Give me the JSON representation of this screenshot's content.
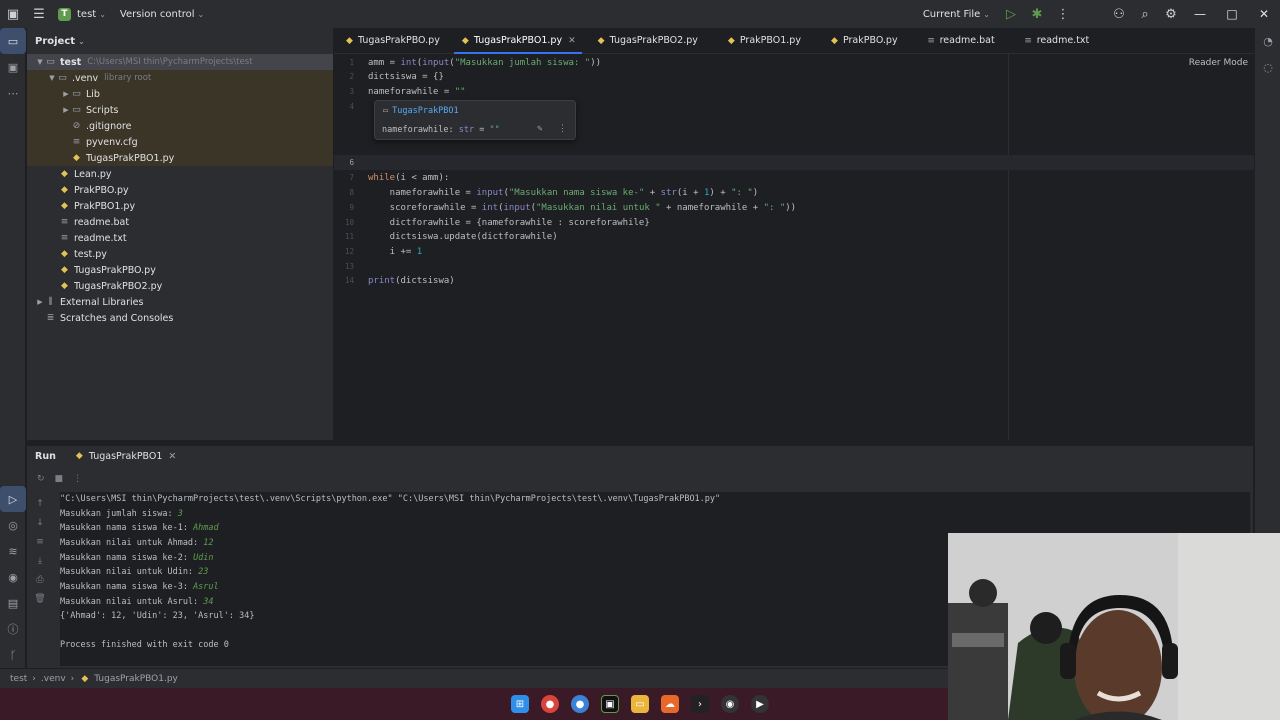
{
  "titlebar": {
    "project_badge": "T",
    "project_name": "test",
    "vcs": "Version control",
    "run_config": "Current File"
  },
  "project_panel": {
    "title": "Project",
    "tree": [
      {
        "label": "test",
        "extra": "C:\\Users\\MSI thin\\PycharmProjects\\test",
        "icon": "folder-icon"
      },
      {
        "label": ".venv",
        "extra": "library root",
        "icon": "folder-icon"
      },
      {
        "label": "Lib",
        "extra": "",
        "icon": "folder-icon"
      },
      {
        "label": "Scripts",
        "extra": "",
        "icon": "folder-icon"
      },
      {
        "label": ".gitignore",
        "extra": "",
        "icon": "ignore-file-icon"
      },
      {
        "label": "pyvenv.cfg",
        "extra": "",
        "icon": "config-file-icon"
      },
      {
        "label": "TugasPrakPBO1.py",
        "extra": "",
        "icon": "python-file-icon"
      },
      {
        "label": "Lean.py",
        "extra": "",
        "icon": "python-file-icon"
      },
      {
        "label": "PrakPBO.py",
        "extra": "",
        "icon": "python-file-icon"
      },
      {
        "label": "PrakPBO1.py",
        "extra": "",
        "icon": "python-file-icon"
      },
      {
        "label": "readme.bat",
        "extra": "",
        "icon": "text-file-icon"
      },
      {
        "label": "readme.txt",
        "extra": "",
        "icon": "text-file-icon"
      },
      {
        "label": "test.py",
        "extra": "",
        "icon": "python-file-icon"
      },
      {
        "label": "TugasPrakPBO.py",
        "extra": "",
        "icon": "python-file-icon"
      },
      {
        "label": "TugasPrakPBO2.py",
        "extra": "",
        "icon": "python-file-icon"
      },
      {
        "label": "External Libraries",
        "extra": "",
        "icon": "library-icon"
      },
      {
        "label": "Scratches and Consoles",
        "extra": "",
        "icon": "scratches-icon"
      }
    ]
  },
  "editor": {
    "tabs": [
      {
        "label": "TugasPrakPBO.py"
      },
      {
        "label": "TugasPrakPBO1.py"
      },
      {
        "label": "TugasPrakPBO2.py"
      },
      {
        "label": "PrakPBO1.py"
      },
      {
        "label": "PrakPBO.py"
      },
      {
        "label": "readme.bat"
      },
      {
        "label": "readme.txt"
      }
    ],
    "active_tab": 1,
    "reader_mode": "Reader Mode",
    "line_numbers": [
      "1",
      "2",
      "3",
      "4",
      "5",
      "6",
      "7",
      "8",
      "9",
      "10",
      "11",
      "12",
      "13",
      "14"
    ],
    "code": {
      "l1": [
        "amm = ",
        "int",
        "(",
        "input",
        "(",
        "\"Masukkan jumlah siswa: \"",
        "))"
      ],
      "l2": "dictsiswa = {}",
      "l3a": "nameforawhile = ",
      "l3b": "\"\"",
      "l7a": "while",
      "l7b": "(i < amm):",
      "l8": [
        "    nameforawhile = ",
        "input",
        "(",
        "\"Masukkan nama siswa ke-\"",
        " + ",
        "str",
        "(i + ",
        "1",
        ") + ",
        "\": \"",
        ")"
      ],
      "l9": [
        "    scoreforawhile = ",
        "int",
        "(",
        "input",
        "(",
        "\"Masukkan nilai untuk \"",
        " + nameforawhile + ",
        "\": \"",
        "))"
      ],
      "l10": "    dictforawhile = {nameforawhile : scoreforawhile}",
      "l11": "    dictsiswa.update(dictforawhile)",
      "l12a": "    i += ",
      "l12b": "1",
      "l14a": "print",
      "l14b": "(dictsiswa)"
    },
    "popup": {
      "file": "TugasPrakPBO1",
      "signature_a": "nameforawhile: ",
      "signature_b": "str",
      "signature_c": " = ",
      "signature_d": "\"\""
    }
  },
  "run_panel": {
    "title": "Run",
    "tab": "TugasPrakPBO1",
    "console": [
      {
        "text": "\"C:\\Users\\MSI thin\\PycharmProjects\\test\\.venv\\Scripts\\python.exe\" \"C:\\Users\\MSI thin\\PycharmProjects\\test\\.venv\\TugasPrakPBO1.py\"",
        "input": ""
      },
      {
        "text": "Masukkan jumlah siswa: ",
        "input": "3"
      },
      {
        "text": "Masukkan nama siswa ke-1: ",
        "input": "Ahmad"
      },
      {
        "text": "Masukkan nilai untuk Ahmad: ",
        "input": "12"
      },
      {
        "text": "Masukkan nama siswa ke-2: ",
        "input": "Udin"
      },
      {
        "text": "Masukkan nilai untuk Udin: ",
        "input": "23"
      },
      {
        "text": "Masukkan nama siswa ke-3: ",
        "input": "Asrul"
      },
      {
        "text": "Masukkan nilai untuk Asrul: ",
        "input": "34"
      },
      {
        "text": "{'Ahmad': 12, 'Udin': 23, 'Asrul': 34}",
        "input": ""
      },
      {
        "text": "",
        "input": ""
      },
      {
        "text": "Process finished with exit code 0",
        "input": ""
      }
    ]
  },
  "statusbar": {
    "crumbs": [
      "test",
      ".venv",
      "TugasPrakPBO1.py"
    ]
  },
  "colors": {
    "accent": "#3574f0",
    "background": "#1e1f22",
    "panel": "#2b2d30",
    "taskbar": "#3a1a26"
  }
}
